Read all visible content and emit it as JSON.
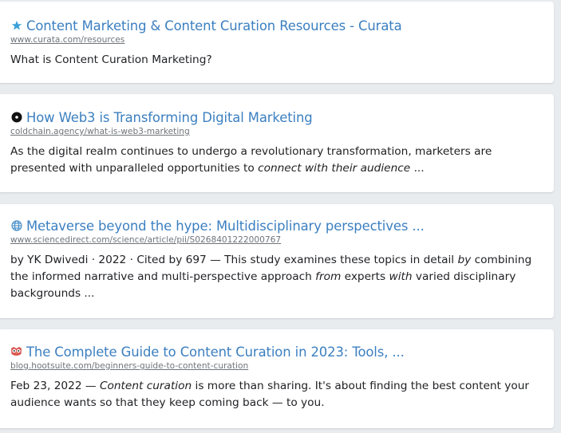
{
  "results": [
    {
      "icon": "star-favicon-icon",
      "title": "Content Marketing & Content Curation Resources - Curata",
      "url": "www.curata.com/resources",
      "snippet": [
        {
          "text": "What is Content Curation Marketing?",
          "em": false
        }
      ]
    },
    {
      "icon": "coldchain-favicon-icon",
      "title": "How Web3 is Transforming Digital Marketing",
      "url": "coldchain.agency/what-is-web3-marketing",
      "snippet": [
        {
          "text": "As the digital realm continues to undergo a revolutionary transformation, marketers are presented with unparalleled opportunities to ",
          "em": false
        },
        {
          "text": "connect with their audience",
          "em": true
        },
        {
          "text": " ...",
          "em": false
        }
      ]
    },
    {
      "icon": "globe-favicon-icon",
      "title": "Metaverse beyond the hype: Multidisciplinary perspectives ...",
      "url": "www.sciencedirect.com/science/article/pii/S0268401222000767",
      "snippet": [
        {
          "text": "by YK Dwivedi · 2022 · Cited by 697 — This study examines these topics in detail ",
          "em": false
        },
        {
          "text": "by",
          "em": true
        },
        {
          "text": " combining the informed narrative and multi-perspective approach ",
          "em": false
        },
        {
          "text": "from",
          "em": true
        },
        {
          "text": " experts ",
          "em": false
        },
        {
          "text": "with",
          "em": true
        },
        {
          "text": " varied disciplinary backgrounds ...",
          "em": false
        }
      ]
    },
    {
      "icon": "owl-favicon-icon",
      "title": "The Complete Guide to Content Curation in 2023: Tools, ...",
      "url": "blog.hootsuite.com/beginners-guide-to-content-curation",
      "snippet": [
        {
          "text": "Feb 23, 2022 — ",
          "em": false
        },
        {
          "text": "Content curation",
          "em": true
        },
        {
          "text": " is more than sharing. It's about finding the best content your audience wants so that they keep coming back — to you.",
          "em": false
        }
      ]
    }
  ],
  "colors": {
    "link": "#3b7fc0",
    "url": "#6f757a",
    "background": "#e9ecef"
  }
}
